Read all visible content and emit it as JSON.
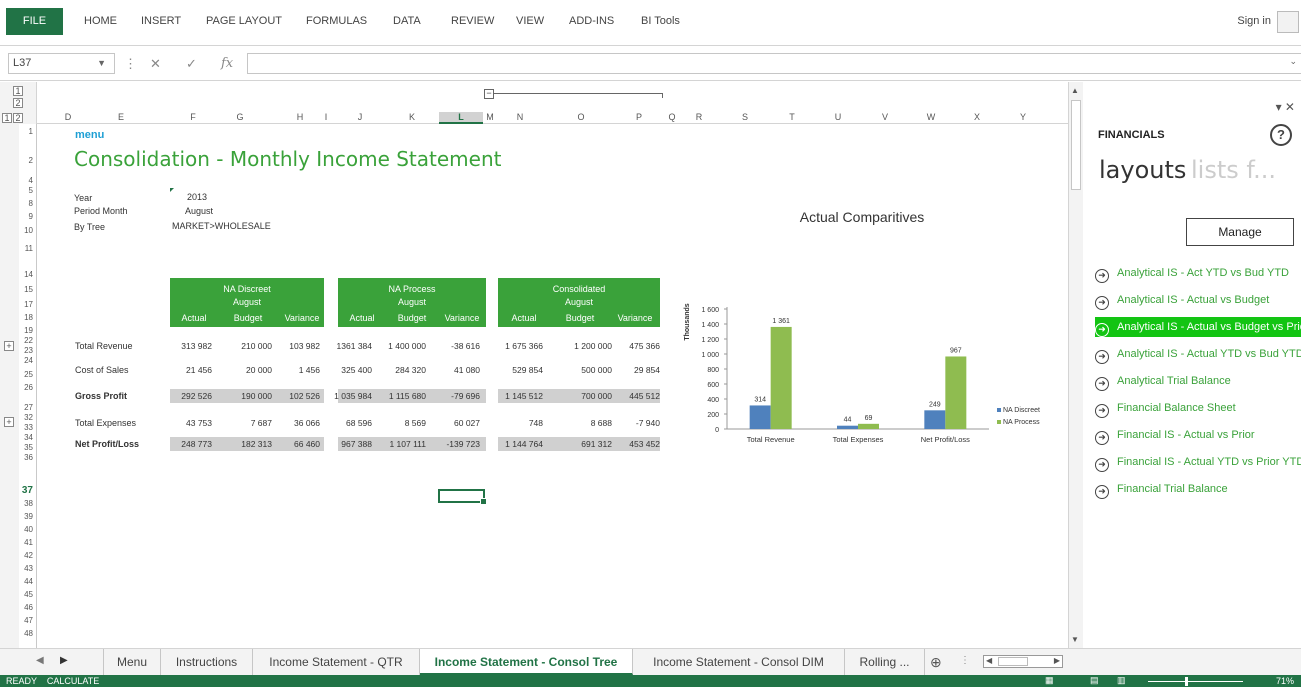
{
  "ribbon": {
    "file": "FILE",
    "tabs": [
      "HOME",
      "INSERT",
      "PAGE LAYOUT",
      "FORMULAS",
      "DATA",
      "REVIEW",
      "VIEW",
      "ADD-INS",
      "BI Tools"
    ],
    "sign_in": "Sign in"
  },
  "formula_bar": {
    "name_box": "L37",
    "cancel": "✕",
    "enter": "✓",
    "fx": "fx",
    "formula": ""
  },
  "outline": {
    "levels_row": [
      "1",
      "2"
    ],
    "levels_col": [
      "1",
      "2"
    ]
  },
  "columns": [
    "D",
    "E",
    "F",
    "G",
    "H",
    "I",
    "J",
    "K",
    "L",
    "M",
    "N",
    "O",
    "P",
    "Q",
    "R",
    "S",
    "T",
    "U",
    "V",
    "W",
    "X",
    "Y"
  ],
  "rows": [
    "1",
    "2",
    "4",
    "5",
    "8",
    "9",
    "10",
    "11",
    "14",
    "15",
    "17",
    "18",
    "19",
    "22",
    "23",
    "24",
    "25",
    "26",
    "27",
    "32",
    "33",
    "34",
    "35",
    "36",
    "37",
    "38",
    "39",
    "40",
    "41",
    "42",
    "43",
    "44",
    "45",
    "46",
    "47",
    "48"
  ],
  "sheet": {
    "menu_link": "menu",
    "title": "Consolidation - Monthly Income Statement",
    "params": [
      {
        "label": "Year",
        "value": "2013"
      },
      {
        "label": "Period Month",
        "value": "August"
      },
      {
        "label": "By Tree",
        "value": "MARKET>WHOLESALE"
      }
    ],
    "groups": [
      {
        "name": "NA Discreet",
        "period": "August",
        "cols": [
          "Actual",
          "Budget",
          "Variance"
        ]
      },
      {
        "name": "NA Process",
        "period": "August",
        "cols": [
          "Actual",
          "Budget",
          "Variance"
        ]
      },
      {
        "name": "Consolidated",
        "period": "August",
        "cols": [
          "Actual",
          "Budget",
          "Variance"
        ]
      }
    ],
    "lines": [
      {
        "label": "Total Revenue",
        "values": [
          "313 982",
          "210 000",
          "103 982",
          "1361 384",
          "1 400 000",
          "-38 616",
          "1 675 366",
          "1 200 000",
          "475 366"
        ]
      },
      {
        "label": "Cost of Sales",
        "values": [
          "21 456",
          "20 000",
          "1 456",
          "325 400",
          "284 320",
          "41 080",
          "529 854",
          "500 000",
          "29 854"
        ]
      },
      {
        "label": "Gross Profit",
        "values": [
          "292 526",
          "190 000",
          "102 526",
          "1 035 984",
          "1 115 680",
          "-79 696",
          "1 145 512",
          "700 000",
          "445 512"
        ]
      },
      {
        "label": "Total Expenses",
        "values": [
          "43 753",
          "7 687",
          "36 066",
          "68 596",
          "8 569",
          "60 027",
          "748",
          "8 688",
          "-7 940"
        ]
      },
      {
        "label": "Net Profit/Loss",
        "values": [
          "248 773",
          "182 313",
          "66 460",
          "967 388",
          "1 107 111",
          "-139 723",
          "1 144 764",
          "691 312",
          "453 452"
        ]
      }
    ]
  },
  "chart_data": {
    "type": "bar",
    "title": "Actual Comparitives",
    "ylabel": "Thousands",
    "categories": [
      "Total Revenue",
      "Total Expenses",
      "Net Profit/Loss"
    ],
    "series": [
      {
        "name": "NA Discreet",
        "values": [
          314,
          44,
          249
        ],
        "color": "#4f81bd"
      },
      {
        "name": "NA Process",
        "values": [
          1361,
          69,
          967
        ],
        "color": "#8fbc50"
      }
    ],
    "data_labels": [
      [
        "314",
        "44",
        "249"
      ],
      [
        "1 361",
        "69",
        "967"
      ]
    ],
    "yticks": [
      "0",
      "200",
      "400",
      "600",
      "800",
      "1 000",
      "1 200",
      "1 400",
      "1 600"
    ],
    "ylim": [
      0,
      1600
    ],
    "legend": "right"
  },
  "panel": {
    "title": "FINANCIALS",
    "help": "?",
    "tab_layouts": "layouts",
    "tab_lists": "lists f...",
    "manage": "Manage",
    "items": [
      "Analytical IS - Act YTD vs Bud YTD",
      "Analytical IS - Actual vs Budget",
      "Analytical IS - Actual vs Budget vs Prior",
      "Analytical IS - Actual YTD vs Bud YTD",
      "Analytical Trial Balance",
      "Financial Balance Sheet",
      "Financial IS - Actual vs Prior",
      "Financial IS - Actual YTD vs Prior YTD",
      "Financial Trial Balance"
    ],
    "selected_index": 2,
    "controls": "▾ ✕"
  },
  "tabs": {
    "items": [
      "Menu",
      "Instructions",
      "Income Statement - QTR",
      "Income Statement - Consol Tree",
      "Income Statement - Consol DIM",
      "Rolling ..."
    ],
    "active_index": 3,
    "add": "⊕"
  },
  "status": {
    "left": "READY    CALCULATE",
    "zoom": "71%"
  }
}
